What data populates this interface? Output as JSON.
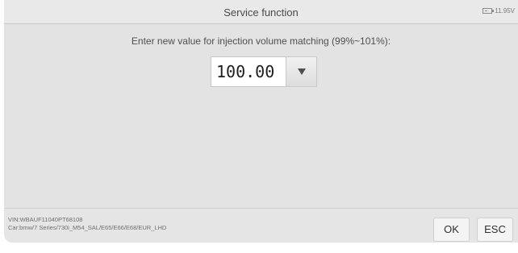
{
  "header": {
    "title": "Service function",
    "battery_voltage": "11.95V",
    "battery_icon": "battery-icon"
  },
  "main": {
    "prompt": "Enter new value for injection volume matching (99%~101%):",
    "value_field": {
      "value": "100.00"
    },
    "dropdown_icon": "chevron-down-icon"
  },
  "footer": {
    "vin": "VIN:WBAUF11040PT68108",
    "car": "Car:bmw/7 Series/730i_M54_SAL/E65/E66/E68/EUR_LHD",
    "ok_label": "OK",
    "esc_label": "ESC"
  }
}
